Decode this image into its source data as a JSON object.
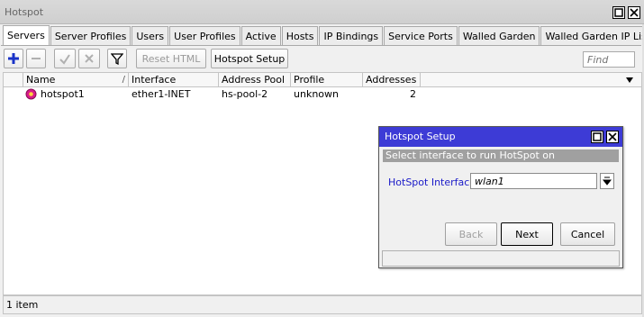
{
  "window": {
    "title": "Hotspot"
  },
  "tabs": [
    {
      "label": "Servers"
    },
    {
      "label": "Server Profiles"
    },
    {
      "label": "Users"
    },
    {
      "label": "User Profiles"
    },
    {
      "label": "Active"
    },
    {
      "label": "Hosts"
    },
    {
      "label": "IP Bindings"
    },
    {
      "label": "Service Ports"
    },
    {
      "label": "Walled Garden"
    },
    {
      "label": "Walled Garden IP List"
    },
    {
      "label": "..."
    }
  ],
  "toolbar": {
    "reset_html_label": "Reset HTML",
    "hotspot_setup_label": "Hotspot Setup",
    "find_placeholder": "Find",
    "icons": [
      "plus-icon",
      "minus-icon",
      "check-icon",
      "x-icon",
      "filter-icon"
    ]
  },
  "table": {
    "columns": [
      "Name",
      "Interface",
      "Address Pool",
      "Profile",
      "Addresses ..."
    ],
    "rows": [
      {
        "name": "hotspot1",
        "interface": "ether1-INET",
        "address_pool": "hs-pool-2",
        "profile": "unknown",
        "addresses": "2"
      }
    ]
  },
  "status": {
    "text": "1 item"
  },
  "dialog": {
    "title": "Hotspot Setup",
    "message": "Select interface to run HotSpot on",
    "field_label": "HotSpot Interface:",
    "field_value": "wlan1",
    "back_label": "Back",
    "next_label": "Next",
    "cancel_label": "Cancel"
  },
  "colors": {
    "dialog_title_bg": "#3d3bd6",
    "label_blue": "#1a1ac8",
    "plus_blue": "#1a33c8"
  }
}
